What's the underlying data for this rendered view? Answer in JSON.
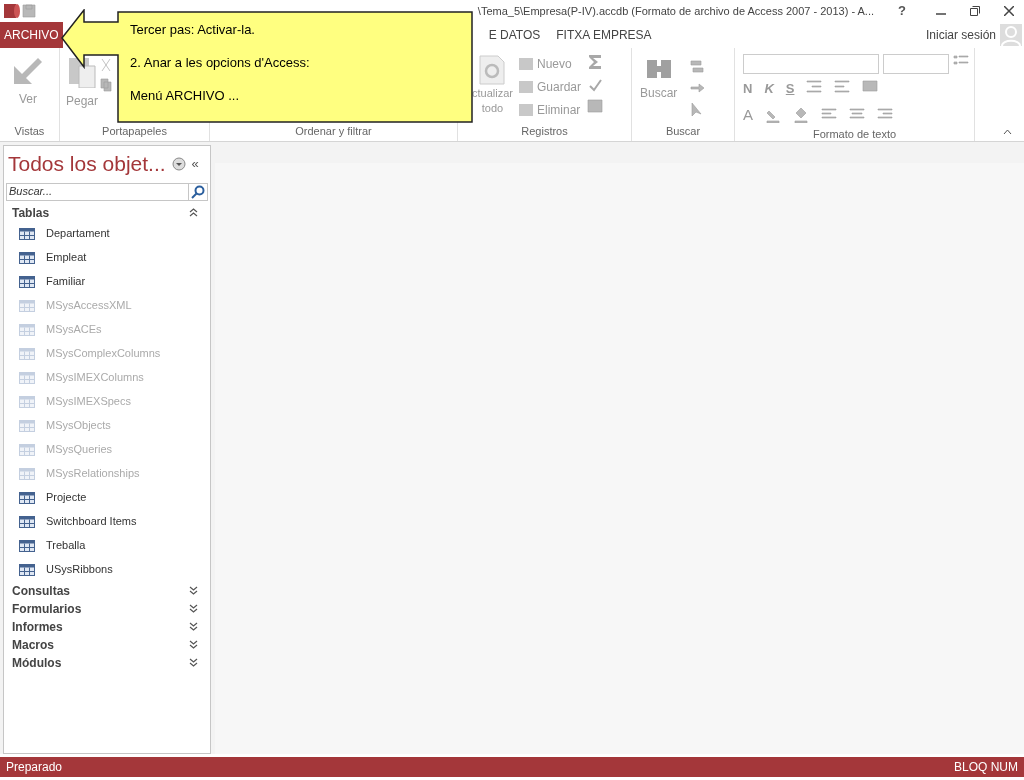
{
  "title_bar": {
    "title": "\\Tema_5\\Empresa(P-IV).accdb (Formato de archivo de Access 2007 - 2013) - A...",
    "help": "?"
  },
  "tabs": [
    {
      "label": "ARCHIVO",
      "selected": true
    },
    {
      "label": "E DATOS",
      "selected": false
    },
    {
      "label": "FITXA EMPRESA",
      "selected": false
    }
  ],
  "sign_in": "Iniciar sesión",
  "ribbon": {
    "groups": [
      {
        "label": "Vistas",
        "kind": "vistas",
        "buttons": [
          "Ver"
        ]
      },
      {
        "label": "Portapapeles",
        "kind": "portapapeles",
        "buttons": [
          "Pegar"
        ]
      },
      {
        "label": "Ordenar y filtrar",
        "kind": "ordenar"
      },
      {
        "label": "Registros",
        "kind": "registros",
        "buttons": [
          "ctualizar",
          "todo",
          "Nuevo",
          "Guardar",
          "Eliminar"
        ]
      },
      {
        "label": "Buscar",
        "kind": "buscar",
        "buttons": [
          "Buscar"
        ]
      },
      {
        "label": "Formato de texto",
        "kind": "formato",
        "buttons": [
          "N",
          "K",
          "S",
          "A"
        ]
      }
    ]
  },
  "callout": {
    "lines": [
      "Tercer pas: Activar-la.",
      "2. Anar a les opcions d'Access:",
      "Menú ARCHIVO ..."
    ]
  },
  "nav": {
    "title": "Todos los objet...",
    "shutter": "«",
    "search_placeholder": "Buscar...",
    "groups": [
      {
        "label": "Tablas",
        "expanded": true,
        "items": [
          {
            "label": "Departament",
            "hidden": false
          },
          {
            "label": "Empleat",
            "hidden": false
          },
          {
            "label": "Familiar",
            "hidden": false
          },
          {
            "label": "MSysAccessXML",
            "hidden": true
          },
          {
            "label": "MSysACEs",
            "hidden": true
          },
          {
            "label": "MSysComplexColumns",
            "hidden": true
          },
          {
            "label": "MSysIMEXColumns",
            "hidden": true
          },
          {
            "label": "MSysIMEXSpecs",
            "hidden": true
          },
          {
            "label": "MSysObjects",
            "hidden": true
          },
          {
            "label": "MSysQueries",
            "hidden": true
          },
          {
            "label": "MSysRelationships",
            "hidden": true
          },
          {
            "label": "Projecte",
            "hidden": false
          },
          {
            "label": "Switchboard Items",
            "hidden": false
          },
          {
            "label": "Treballa",
            "hidden": false
          },
          {
            "label": "USysRibbons",
            "hidden": false
          }
        ]
      },
      {
        "label": "Consultas",
        "expanded": false
      },
      {
        "label": "Formularios",
        "expanded": false
      },
      {
        "label": "Informes",
        "expanded": false
      },
      {
        "label": "Macros",
        "expanded": false
      },
      {
        "label": "Módulos",
        "expanded": false
      }
    ]
  },
  "status_bar": {
    "left": "Preparado",
    "right": "BLOQ NUM"
  }
}
